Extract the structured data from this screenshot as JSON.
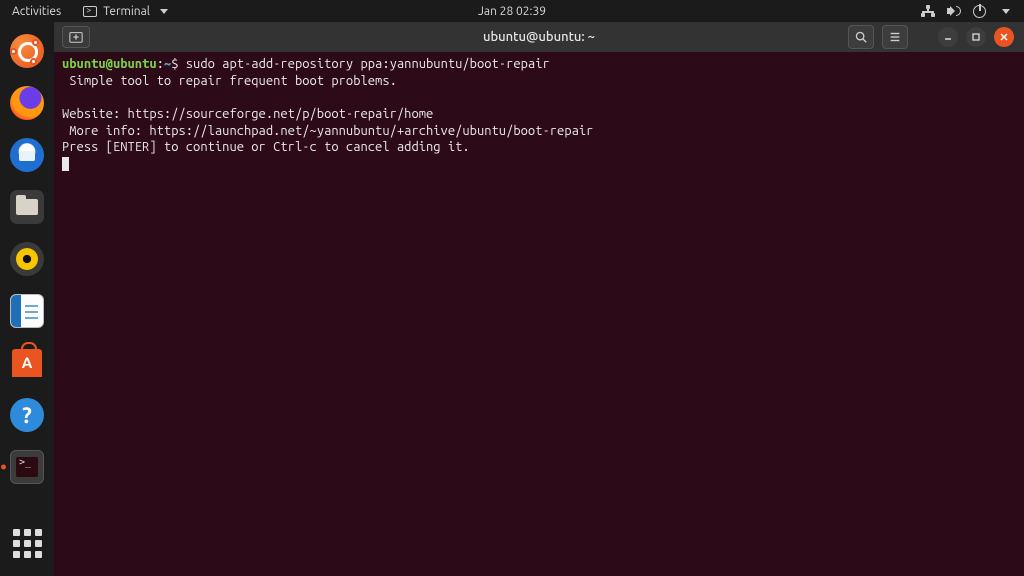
{
  "topbar": {
    "activities": "Activities",
    "app_menu_label": "Terminal",
    "datetime": "Jan 28  02:39"
  },
  "dock": {
    "tooltip_writer": "LibreOffice Writer"
  },
  "window": {
    "title": "ubuntu@ubuntu: ~"
  },
  "terminal": {
    "prompt_user": "ubuntu@ubuntu",
    "prompt_path": "~",
    "command": "sudo apt-add-repository ppa:yannubuntu/boot-repair",
    "line1": " Simple tool to repair frequent boot problems.",
    "blank": "",
    "line2": "Website: https://sourceforge.net/p/boot-repair/home",
    "line3": " More info: https://launchpad.net/~yannubuntu/+archive/ubuntu/boot-repair",
    "line4": "Press [ENTER] to continue or Ctrl-c to cancel adding it."
  }
}
